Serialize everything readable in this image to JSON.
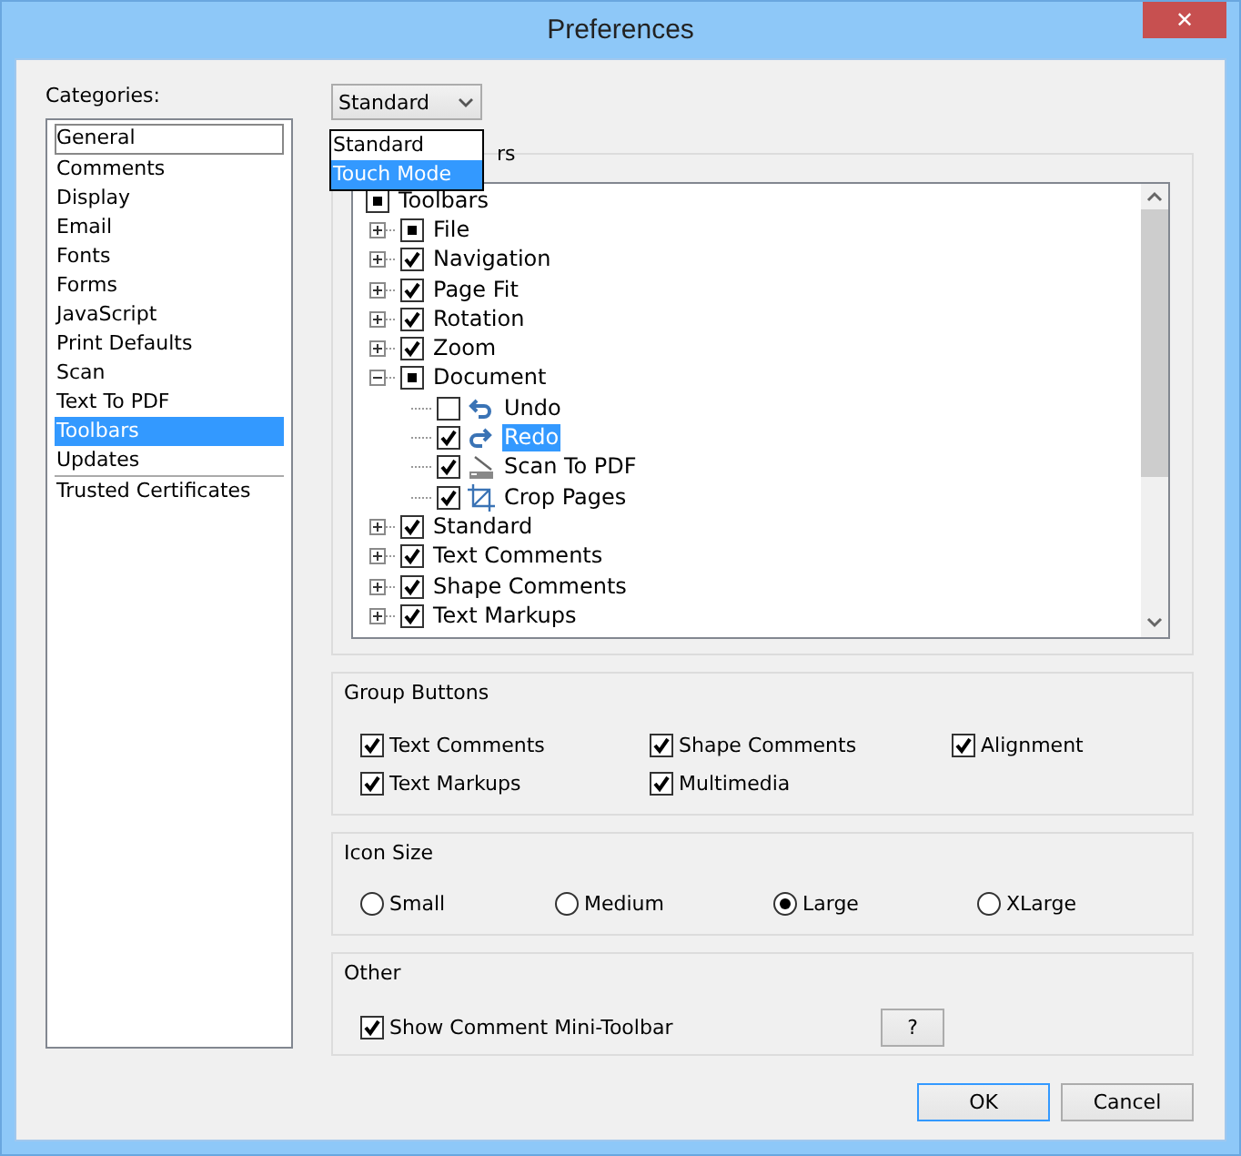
{
  "window": {
    "title": "Preferences",
    "close": "✕"
  },
  "categories": {
    "label": "Categories:",
    "items": [
      {
        "label": "General",
        "selected": false,
        "focused": true
      },
      {
        "label": "Comments",
        "selected": false,
        "focused": false
      },
      {
        "label": "Display",
        "selected": false,
        "focused": false
      },
      {
        "label": "Email",
        "selected": false,
        "focused": false
      },
      {
        "label": "Fonts",
        "selected": false,
        "focused": false
      },
      {
        "label": "Forms",
        "selected": false,
        "focused": false
      },
      {
        "label": "JavaScript",
        "selected": false,
        "focused": false
      },
      {
        "label": "Print Defaults",
        "selected": false,
        "focused": false
      },
      {
        "label": "Scan",
        "selected": false,
        "focused": false
      },
      {
        "label": "Text To PDF",
        "selected": false,
        "focused": false
      },
      {
        "label": "Toolbars",
        "selected": true,
        "focused": false
      },
      {
        "label": "Updates",
        "selected": false,
        "focused": false
      },
      {
        "label": "Trusted Certificates",
        "selected": false,
        "focused": false
      }
    ]
  },
  "mode_select": {
    "value": "Standard",
    "options": [
      {
        "label": "Standard",
        "highlighted": false
      },
      {
        "label": "Touch Mode",
        "highlighted": true
      }
    ]
  },
  "toolbars_group": {
    "label": "rs",
    "tree": [
      {
        "label": "Toolbars",
        "mixed": true,
        "selected": false,
        "children": [
          {
            "label": "File",
            "mixed": true,
            "selected": false,
            "expanded": false
          },
          {
            "label": "Navigation",
            "checked": true,
            "mixed": false,
            "selected": false,
            "expanded": false
          },
          {
            "label": "Page Fit",
            "checked": true,
            "mixed": false,
            "selected": false,
            "expanded": false
          },
          {
            "label": "Rotation",
            "checked": true,
            "mixed": false,
            "selected": false,
            "expanded": false
          },
          {
            "label": "Zoom",
            "checked": true,
            "mixed": false,
            "selected": false,
            "expanded": false
          },
          {
            "label": "Document",
            "mixed": true,
            "selected": false,
            "expanded": true,
            "children": [
              {
                "label": "Undo",
                "checked": false,
                "mixed": false,
                "selected": false
              },
              {
                "label": "Redo",
                "checked": true,
                "mixed": false,
                "selected": true
              },
              {
                "label": "Scan To PDF",
                "checked": true,
                "mixed": false,
                "selected": false
              },
              {
                "label": "Crop Pages",
                "checked": true,
                "mixed": false,
                "selected": false
              }
            ]
          },
          {
            "label": "Standard",
            "checked": true,
            "mixed": false,
            "selected": false,
            "expanded": false
          },
          {
            "label": "Text Comments",
            "checked": true,
            "mixed": false,
            "selected": false,
            "expanded": false
          },
          {
            "label": "Shape Comments",
            "checked": true,
            "mixed": false,
            "selected": false,
            "expanded": false
          },
          {
            "label": "Text Markups",
            "checked": true,
            "mixed": false,
            "selected": false,
            "expanded": false
          }
        ]
      }
    ]
  },
  "group_buttons": {
    "label": "Group Buttons",
    "items": [
      {
        "label": "Text Comments",
        "checked": true
      },
      {
        "label": "Shape Comments",
        "checked": true
      },
      {
        "label": "Alignment",
        "checked": true
      },
      {
        "label": "Text Markups",
        "checked": true
      },
      {
        "label": "Multimedia",
        "checked": true
      }
    ]
  },
  "icon_size": {
    "label": "Icon Size",
    "options": [
      {
        "label": "Small",
        "selected": false
      },
      {
        "label": "Medium",
        "selected": false
      },
      {
        "label": "Large",
        "selected": true
      },
      {
        "label": "XLarge",
        "selected": false
      }
    ]
  },
  "other": {
    "label": "Other",
    "items": [
      {
        "label": "Show Comment Mini-Toolbar",
        "checked": true
      }
    ],
    "help_button": "?"
  },
  "buttons": [
    {
      "label": "OK",
      "default": true
    },
    {
      "label": "Cancel",
      "default": false
    }
  ]
}
